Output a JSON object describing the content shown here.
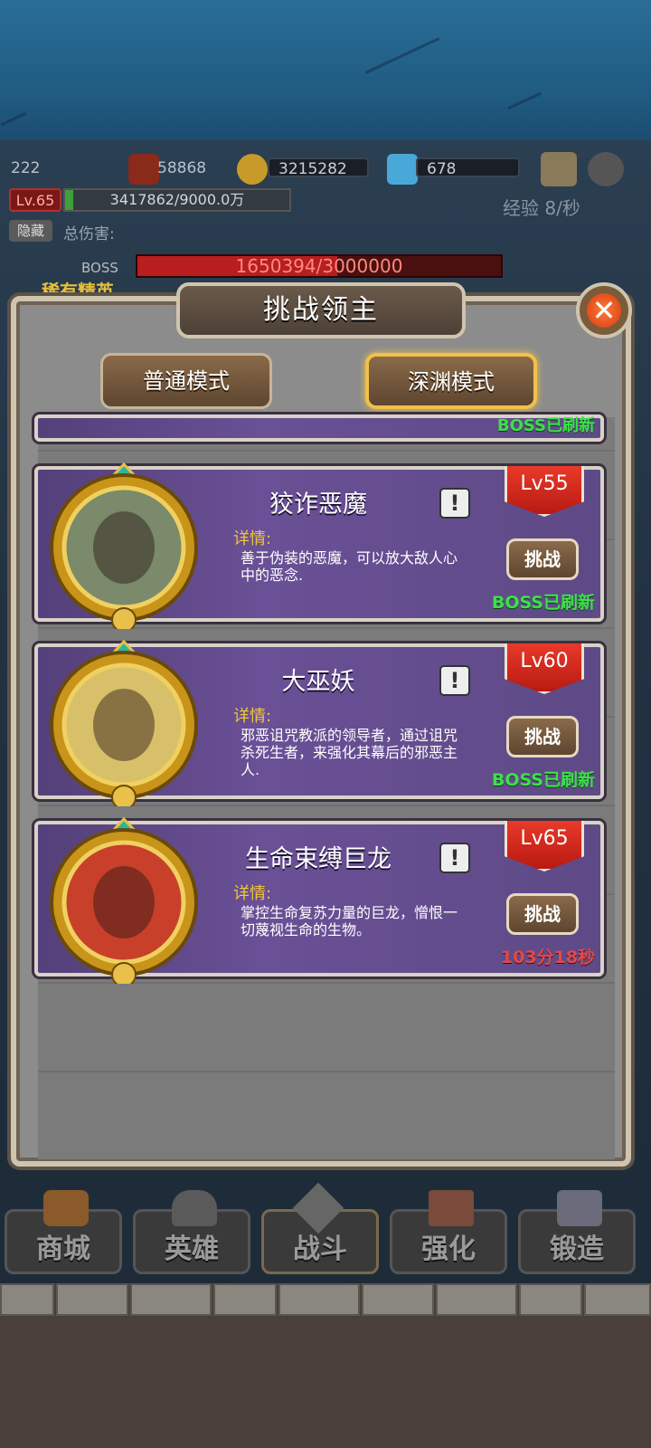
{
  "hud": {
    "player_id": "222",
    "attack": "58868",
    "gold": "3215282",
    "gems": "678",
    "level": "Lv.65",
    "xp": "3417862/9000.0万",
    "xp_fill_pct": 3.8,
    "exp_rate": "经验 8/秒",
    "hide_label": "隐藏",
    "total_damage_label": "总伤害:",
    "boss_label": "BOSS",
    "boss_hp": "1650394/3000000",
    "boss_hp_fill_pct": 55,
    "rare_elite": "稀有精英"
  },
  "dialog": {
    "title": "挑战领主",
    "normal_mode": "普通模式",
    "abyss_mode": "深渊模式",
    "active_mode": "深渊模式"
  },
  "partial_card": {
    "status": "BOSS已刷新"
  },
  "bosses": [
    {
      "name": "狡诈恶魔",
      "detail_label": "详情:",
      "description": "善于伪装的恶魔，可以放大敌人心中的恶念.",
      "level": "Lv55",
      "fight_label": "挑战",
      "status": "BOSS已刷新",
      "status_type": "ready"
    },
    {
      "name": "大巫妖",
      "detail_label": "详情:",
      "description": "邪恶诅咒教派的领导者，通过诅咒杀死生者，来强化其幕后的邪恶主人.",
      "level": "Lv60",
      "fight_label": "挑战",
      "status": "BOSS已刷新",
      "status_type": "ready"
    },
    {
      "name": "生命束缚巨龙",
      "detail_label": "详情:",
      "description": "掌控生命复苏力量的巨龙，憎恨一切蔑视生命的生物。",
      "level": "Lv65",
      "fight_label": "挑战",
      "status": "103分18秒",
      "status_type": "timer"
    }
  ],
  "nav": [
    {
      "label": "商城",
      "icon": "shop-icon"
    },
    {
      "label": "英雄",
      "icon": "hero-helmet-icon"
    },
    {
      "label": "战斗",
      "icon": "crossed-swords-icon"
    },
    {
      "label": "强化",
      "icon": "hammer-icon"
    },
    {
      "label": "锻造",
      "icon": "anvil-icon"
    }
  ],
  "colors": {
    "panel_purple": "#6a5096",
    "active_gold": "#f1c14a",
    "status_green": "#3ee04a",
    "status_red": "#e04a4a",
    "level_red": "#e83a2a"
  }
}
